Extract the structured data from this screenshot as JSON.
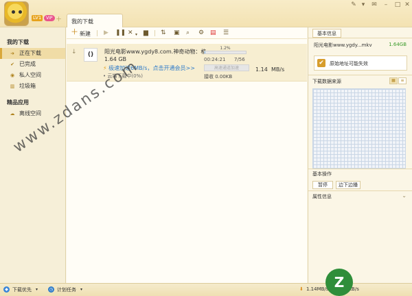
{
  "user": {
    "level": "LV1",
    "vip": "VIP"
  },
  "tabs": {
    "my_downloads": "我的下载"
  },
  "sidebar": {
    "section1": "我的下载",
    "items": [
      {
        "label": "正在下载"
      },
      {
        "label": "已完成"
      },
      {
        "label": "私人空间"
      },
      {
        "label": "垃圾箱"
      }
    ],
    "section2": "精品应用",
    "apps": [
      {
        "label": "离线空间"
      }
    ]
  },
  "toolbar": {
    "new_label": "新建"
  },
  "task": {
    "name": "阳光电影www.ygdy8.com.神奇动物：格...",
    "size": "1.64 GB",
    "accel_text": "极速加速6MB/s，点击开通会员>>",
    "cloud_text": "云端下载中(0%)",
    "progress_label": "1.2%",
    "progress": 0.012,
    "elapsed": "00:24:21",
    "pieces": "7/56",
    "accel_button": "高速通道加速",
    "received": "接收 0.00KB",
    "speed": "1.14",
    "speed_unit": "MB/s"
  },
  "right_panel": {
    "tab": "基本信息",
    "file": "阳光电影www.ygdy...mkv",
    "size": "1.64GB",
    "warning": "原始地址可能失效",
    "sources_title": "下载数据来源",
    "ops_title": "基本操作",
    "pause": "暂停",
    "stream": "边下边播",
    "attr_title": "属性信息"
  },
  "status": {
    "priority": "下载优先",
    "plan": "计划任务",
    "speed": "1.14MB/s",
    "upload": "1KB/s"
  },
  "watermark": "www.zdans.com",
  "colors": {
    "accent": "#d9a73a",
    "link": "#2d7ac9",
    "size_green": "#3a9b2a"
  }
}
